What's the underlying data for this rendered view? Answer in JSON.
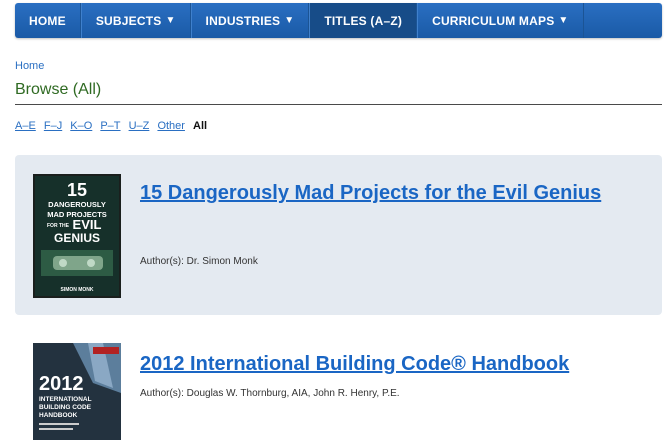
{
  "nav": {
    "items": [
      {
        "label": "HOME",
        "caret": ""
      },
      {
        "label": "SUBJECTS",
        "caret": "▼"
      },
      {
        "label": "INDUSTRIES",
        "caret": "▼"
      },
      {
        "label": "TITLES (A–Z)",
        "caret": ""
      },
      {
        "label": "CURRICULUM MAPS",
        "caret": "▼"
      }
    ],
    "active": "TITLES (A–Z)"
  },
  "breadcrumb": "Home",
  "page_title": "Browse (All)",
  "alpha_filter": {
    "links": [
      "A–E",
      "F–J",
      "K–O",
      "P–T",
      "U–Z",
      "Other"
    ],
    "current": "All"
  },
  "results": [
    {
      "title": "15 Dangerously Mad Projects for the Evil Genius",
      "authors": "Author(s): Dr. Simon Monk",
      "cover": {
        "line1": "15",
        "line2": "DANGEROUSLY",
        "line3": "MAD PROJECTS",
        "line4": "FOR THE",
        "line5": "EVIL",
        "line6": "GENIUS",
        "footer": "SIMON MONK"
      }
    },
    {
      "title": "2012 International Building Code® Handbook",
      "authors": "Author(s): Douglas W. Thornburg, AIA, John R. Henry, P.E.",
      "cover": {
        "year": "2012",
        "line1": "INTERNATIONAL",
        "line2": "BUILDING CODE",
        "line3": "HANDBOOK"
      }
    }
  ],
  "colors": {
    "nav_blue": "#1a5aa6",
    "link_blue": "#1a66c4",
    "title_green": "#2f6a22",
    "card_bg": "#e4eaf1"
  }
}
